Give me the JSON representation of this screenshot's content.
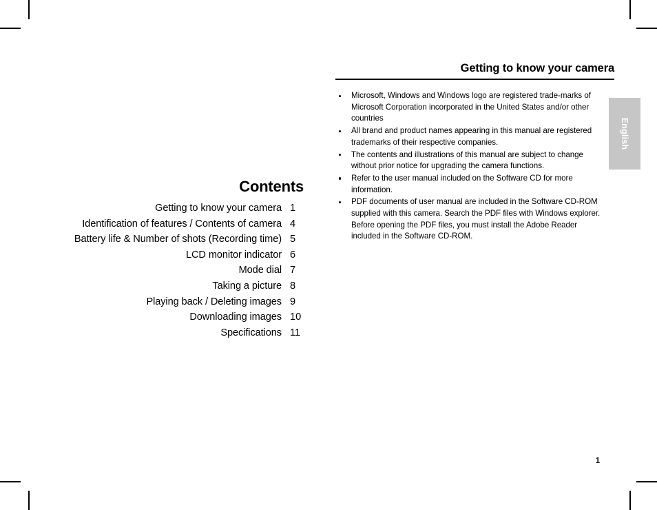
{
  "document": {
    "page_number": "1",
    "language_tab": "English",
    "gray": "#c6c6c6"
  },
  "left_page": {
    "title": "Contents",
    "entries": [
      {
        "label": "Getting to know your camera",
        "page": "1"
      },
      {
        "label": "Identification of features / Contents of camera",
        "page": "4"
      },
      {
        "label": "Battery life & Number of shots (Recording time)",
        "page": "5"
      },
      {
        "label": "LCD monitor indicator",
        "page": "6"
      },
      {
        "label": "Mode dial",
        "page": "7"
      },
      {
        "label": "Taking a picture",
        "page": "8"
      },
      {
        "label": "Playing back / Deleting images",
        "page": "9"
      },
      {
        "label": "Downloading images",
        "page": "10"
      },
      {
        "label": "Specifications",
        "page": "11"
      }
    ]
  },
  "right_page": {
    "heading": "Getting to know your camera",
    "notes": [
      "Microsoft, Windows and Windows logo are registered trade-marks of Microsoft Corporation incorporated in the United States and/or other countries",
      "All brand and product names appearing in this manual are registered trademarks of their respective companies.",
      "The contents and illustrations of this manual are subject to change without prior notice for upgrading the camera functions.",
      "Refer to the user manual included on the Software CD for more information.",
      "PDF documents of user manual are included in the Software CD-ROM supplied with this camera. Search the PDF files with Windows explorer. Before opening the PDF files, you must install the Adobe Reader included in the Software CD-ROM."
    ]
  }
}
